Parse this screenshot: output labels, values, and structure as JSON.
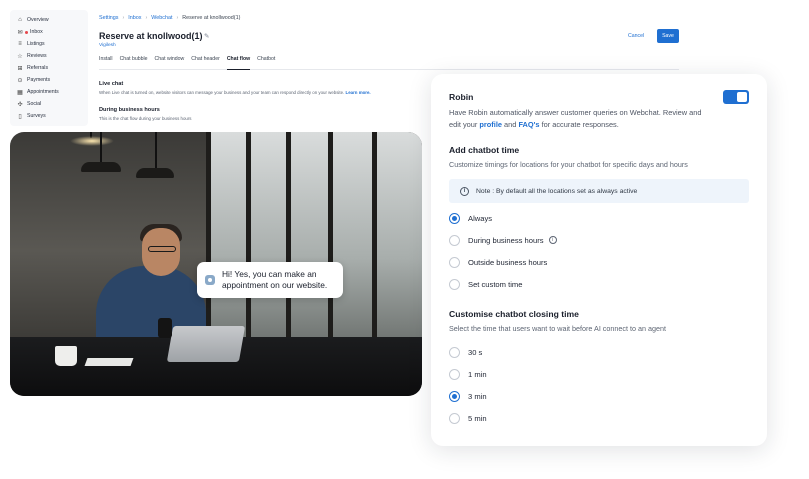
{
  "sidebar": {
    "items": [
      {
        "icon": "home-icon",
        "glyph": "⌂",
        "label": "Overview"
      },
      {
        "icon": "inbox-icon",
        "glyph": "✉",
        "label": "Inbox",
        "notify": true
      },
      {
        "icon": "listings-icon",
        "glyph": "≡",
        "label": "Listings"
      },
      {
        "icon": "reviews-icon",
        "glyph": "☆",
        "label": "Reviews"
      },
      {
        "icon": "referrals-icon",
        "glyph": "⊞",
        "label": "Referrals"
      },
      {
        "icon": "payments-icon",
        "glyph": "⊙",
        "label": "Payments"
      },
      {
        "icon": "appointments-icon",
        "glyph": "▦",
        "label": "Appointments"
      },
      {
        "icon": "social-icon",
        "glyph": "✣",
        "label": "Social"
      },
      {
        "icon": "surveys-icon",
        "glyph": "▯",
        "label": "Surveys"
      }
    ]
  },
  "breadcrumb": [
    "Settings",
    "Inbox",
    "Webchat",
    "Reserve at knollwood(1)"
  ],
  "header": {
    "title": "Reserve at knollwood(1)",
    "owner": "Vigilesh",
    "cancel_label": "Cancel",
    "save_label": "Save"
  },
  "tabs": [
    {
      "label": "Install",
      "active": false
    },
    {
      "label": "Chat bubble",
      "active": false
    },
    {
      "label": "Chat window",
      "active": false
    },
    {
      "label": "Chat header",
      "active": false
    },
    {
      "label": "Chat flow",
      "active": true
    },
    {
      "label": "Chatbot",
      "active": false
    }
  ],
  "sections": {
    "live_chat": {
      "title": "Live chat",
      "desc": "When Live chat is turned on, website visitors can message your business and your team can respond directly on your website.",
      "more": "Learn more."
    },
    "business_hours": {
      "title": "During business hours",
      "desc": "This is the chat flow during your business hours"
    }
  },
  "chat_bubble": {
    "line1": "Hi! Yes, you can make an",
    "line2": "appointment on our website."
  },
  "card": {
    "robin": {
      "title": "Robin",
      "desc_before": "Have Robin automatically answer customer queries on Webchat. Review and edit your ",
      "profile_link": "profile",
      "and": " and ",
      "faq_link": "FAQ's",
      "desc_after": " for accurate responses.",
      "enabled": true
    },
    "chatbot_time": {
      "title": "Add chatbot time",
      "subtitle": "Customize timings for locations for your chatbot for specific days and hours",
      "note": "Note : By default all the locations set as always active",
      "options": [
        {
          "label": "Always",
          "selected": true
        },
        {
          "label": "During business hours",
          "selected": false,
          "info": true
        },
        {
          "label": "Outside business hours",
          "selected": false
        },
        {
          "label": "Set custom time",
          "selected": false
        }
      ]
    },
    "closing_time": {
      "title": "Customise chatbot closing time",
      "subtitle": "Select the time that users want to wait before AI connect to an agent",
      "options": [
        {
          "label": "30 s",
          "selected": false
        },
        {
          "label": "1 min",
          "selected": false
        },
        {
          "label": "3 min",
          "selected": true
        },
        {
          "label": "5 min",
          "selected": false
        }
      ]
    }
  },
  "colors": {
    "accent": "#1f6fd1",
    "note_bg": "#eef4fb"
  }
}
